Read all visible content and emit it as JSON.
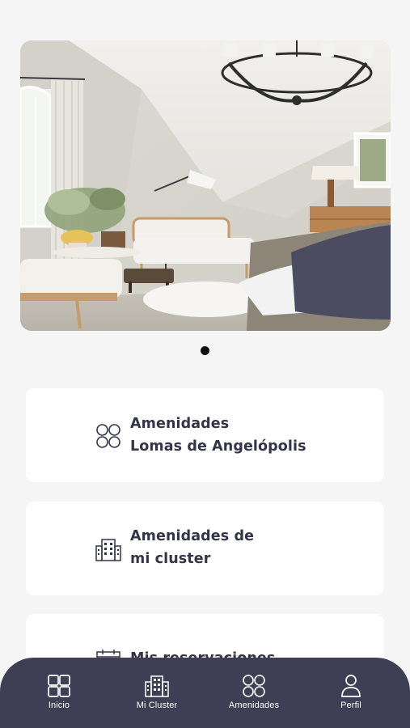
{
  "hero": {
    "slides_count": 1,
    "active_slide": 1
  },
  "cards": [
    {
      "icon": "circles-grid-icon",
      "line1": "Amenidades",
      "line2": "Lomas de Angelópolis"
    },
    {
      "icon": "building-icon",
      "line1": "Amenidades de",
      "line2": "mi cluster"
    },
    {
      "icon": "calendar-icon",
      "line1": "Mis reservaciones",
      "line2": ""
    }
  ],
  "nav": {
    "items": [
      {
        "label": "Inicio",
        "icon": "grid-icon"
      },
      {
        "label": "Mi Cluster",
        "icon": "building-icon"
      },
      {
        "label": "Amenidades",
        "icon": "circles-grid-icon"
      },
      {
        "label": "Perfil",
        "icon": "user-icon"
      }
    ]
  },
  "colors": {
    "background": "#f5f5f5",
    "card": "#ffffff",
    "text": "#33344a",
    "nav_bg": "#3e3e55",
    "dot_active": "#0e0e10"
  }
}
